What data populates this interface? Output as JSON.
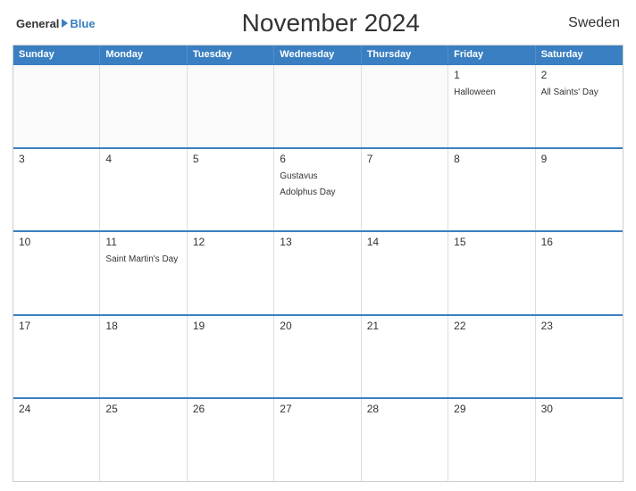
{
  "header": {
    "logo": {
      "general": "General",
      "blue": "Blue"
    },
    "title": "November 2024",
    "country": "Sweden"
  },
  "calendar": {
    "days": [
      "Sunday",
      "Monday",
      "Tuesday",
      "Wednesday",
      "Thursday",
      "Friday",
      "Saturday"
    ],
    "rows": [
      [
        {
          "date": "",
          "event": "",
          "empty": true
        },
        {
          "date": "",
          "event": "",
          "empty": true
        },
        {
          "date": "",
          "event": "",
          "empty": true
        },
        {
          "date": "",
          "event": "",
          "empty": true
        },
        {
          "date": "",
          "event": "",
          "empty": true
        },
        {
          "date": "1",
          "event": "Halloween",
          "empty": false
        },
        {
          "date": "2",
          "event": "All Saints' Day",
          "empty": false
        }
      ],
      [
        {
          "date": "3",
          "event": "",
          "empty": false
        },
        {
          "date": "4",
          "event": "",
          "empty": false
        },
        {
          "date": "5",
          "event": "",
          "empty": false
        },
        {
          "date": "6",
          "event": "Gustavus Adolphus Day",
          "empty": false
        },
        {
          "date": "7",
          "event": "",
          "empty": false
        },
        {
          "date": "8",
          "event": "",
          "empty": false
        },
        {
          "date": "9",
          "event": "",
          "empty": false
        }
      ],
      [
        {
          "date": "10",
          "event": "",
          "empty": false
        },
        {
          "date": "11",
          "event": "Saint Martin's Day",
          "empty": false
        },
        {
          "date": "12",
          "event": "",
          "empty": false
        },
        {
          "date": "13",
          "event": "",
          "empty": false
        },
        {
          "date": "14",
          "event": "",
          "empty": false
        },
        {
          "date": "15",
          "event": "",
          "empty": false
        },
        {
          "date": "16",
          "event": "",
          "empty": false
        }
      ],
      [
        {
          "date": "17",
          "event": "",
          "empty": false
        },
        {
          "date": "18",
          "event": "",
          "empty": false
        },
        {
          "date": "19",
          "event": "",
          "empty": false
        },
        {
          "date": "20",
          "event": "",
          "empty": false
        },
        {
          "date": "21",
          "event": "",
          "empty": false
        },
        {
          "date": "22",
          "event": "",
          "empty": false
        },
        {
          "date": "23",
          "event": "",
          "empty": false
        }
      ],
      [
        {
          "date": "24",
          "event": "",
          "empty": false
        },
        {
          "date": "25",
          "event": "",
          "empty": false
        },
        {
          "date": "26",
          "event": "",
          "empty": false
        },
        {
          "date": "27",
          "event": "",
          "empty": false
        },
        {
          "date": "28",
          "event": "",
          "empty": false
        },
        {
          "date": "29",
          "event": "",
          "empty": false
        },
        {
          "date": "30",
          "event": "",
          "empty": false
        }
      ]
    ]
  }
}
